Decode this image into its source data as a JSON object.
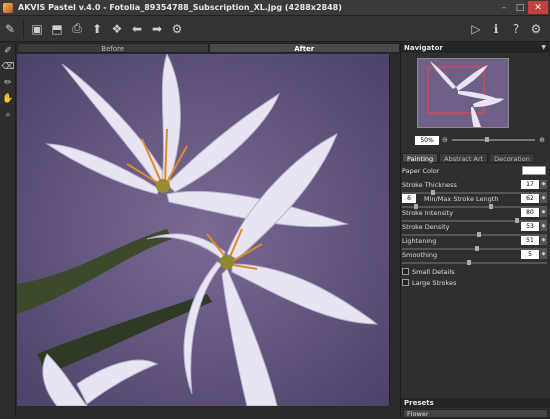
{
  "window": {
    "title": "AKVIS Pastel v.4.0 - Fotolia_89354788_Subscription_XL.jpg (4288x2848)"
  },
  "tabs": {
    "before": "Before",
    "after": "After"
  },
  "navigator": {
    "title": "Navigator",
    "zoom": "50%"
  },
  "panel_tabs": [
    "Painting",
    "Abstract Art",
    "Decoration"
  ],
  "params": {
    "paper_color": "Paper Color",
    "stroke_thickness": {
      "label": "Stroke Thickness",
      "value": "17"
    },
    "min_max": {
      "label": "Min/Max Stroke Length",
      "min": "6",
      "max": "62"
    },
    "stroke_intensity": {
      "label": "Stroke Intensity",
      "value": "80"
    },
    "stroke_density": {
      "label": "Stroke Density",
      "value": "53"
    },
    "lightening": {
      "label": "Lightening",
      "value": "51"
    },
    "smoothing": {
      "label": "Smoothing",
      "value": "5"
    },
    "small_details": "Small Details",
    "large_strokes": "Large Strokes"
  },
  "presets": {
    "title": "Presets",
    "selected": "Flower"
  },
  "colors": {
    "bg": "#2b2b2b",
    "canvas": "#6c5c86",
    "paper": "#ffffff"
  }
}
